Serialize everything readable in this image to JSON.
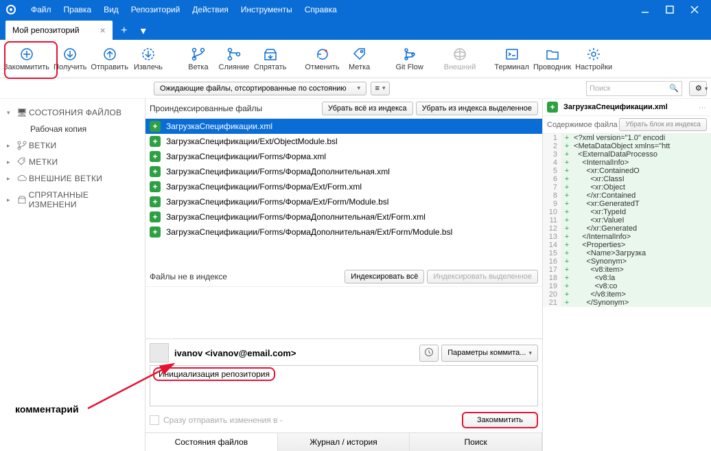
{
  "menu": [
    "Файл",
    "Правка",
    "Вид",
    "Репозиторий",
    "Действия",
    "Инструменты",
    "Справка"
  ],
  "tab": {
    "title": "Мой репозиторий"
  },
  "toolbar": [
    {
      "id": "commit",
      "label": "Закоммитить"
    },
    {
      "id": "pull",
      "label": "Получить"
    },
    {
      "id": "push",
      "label": "Отправить"
    },
    {
      "id": "fetch",
      "label": "Извлечь"
    },
    {
      "id": "branch",
      "label": "Ветка"
    },
    {
      "id": "merge",
      "label": "Слияние"
    },
    {
      "id": "stash",
      "label": "Спрятать"
    },
    {
      "id": "discard",
      "label": "Отменить"
    },
    {
      "id": "tag",
      "label": "Метка"
    },
    {
      "id": "gitflow",
      "label": "Git Flow"
    },
    {
      "id": "remote",
      "label": "Внешний"
    },
    {
      "id": "terminal",
      "label": "Терминал"
    },
    {
      "id": "explorer",
      "label": "Проводник"
    },
    {
      "id": "settings",
      "label": "Настройки"
    }
  ],
  "filter": {
    "pending": "Ожидающие файлы, отсортированные по состоянию",
    "search_placeholder": "Поиск"
  },
  "sidebar": {
    "file_status": "СОСТОЯНИЯ ФАЙЛОВ",
    "working_copy": "Рабочая копия",
    "branches": "ВЕТКИ",
    "tags": "МЕТКИ",
    "remotes": "ВНЕШНИЕ ВЕТКИ",
    "stashes": "СПРЯТАННЫЕ ИЗМЕНЕНИ"
  },
  "staged": {
    "header": "Проиндексированные файлы",
    "unstage_all": "Убрать всё из индекса",
    "unstage_sel": "Убрать из индекса выделенное",
    "files": [
      "ЗагрузкаСпецификации.xml",
      "ЗагрузкаСпецификации/Ext/ObjectModule.bsl",
      "ЗагрузкаСпецификации/Forms/Форма.xml",
      "ЗагрузкаСпецификации/Forms/ФормаДополнительная.xml",
      "ЗагрузкаСпецификации/Forms/Форма/Ext/Form.xml",
      "ЗагрузкаСпецификации/Forms/Форма/Ext/Form/Module.bsl",
      "ЗагрузкаСпецификации/Forms/ФормаДополнительная/Ext/Form.xml",
      "ЗагрузкаСпецификации/Forms/ФормаДополнительная/Ext/Form/Module.bsl"
    ]
  },
  "unstaged": {
    "header": "Файлы не в индексе",
    "stage_all": "Индексировать всё",
    "stage_sel": "Индексировать выделенное"
  },
  "commit": {
    "author": "ivanov <ivanov@email.com>",
    "message": "Инициализация репозитория",
    "push_after": "Сразу отправить изменения в -",
    "options": "Параметры коммита...",
    "do": "Закоммитить"
  },
  "bottom_tabs": [
    "Состояния файлов",
    "Журнал / история",
    "Поиск"
  ],
  "diff": {
    "filename": "ЗагрузкаСпецификации.xml",
    "content_label": "Содержимое файла",
    "unstage_hunk": "Убрать блок из индекса",
    "lines": [
      "<?xml version=\"1.0\" encodi",
      "<MetaDataObject xmlns=\"htt",
      "  <ExternalDataProcesso",
      "    <InternalInfo>",
      "      <xr:ContainedO",
      "        <xr:ClassI",
      "        <xr:Object",
      "      </xr:Contained",
      "      <xr:GeneratedT",
      "        <xr:TypeId",
      "        <xr:ValueI",
      "      </xr:Generated",
      "    </InternalInfo>",
      "    <Properties>",
      "      <Name>Загрузка",
      "      <Synonym>",
      "        <v8:item>",
      "          <v8:la",
      "          <v8:co",
      "        </v8:item>",
      "      </Synonym>"
    ]
  },
  "annotation": "комментарий"
}
